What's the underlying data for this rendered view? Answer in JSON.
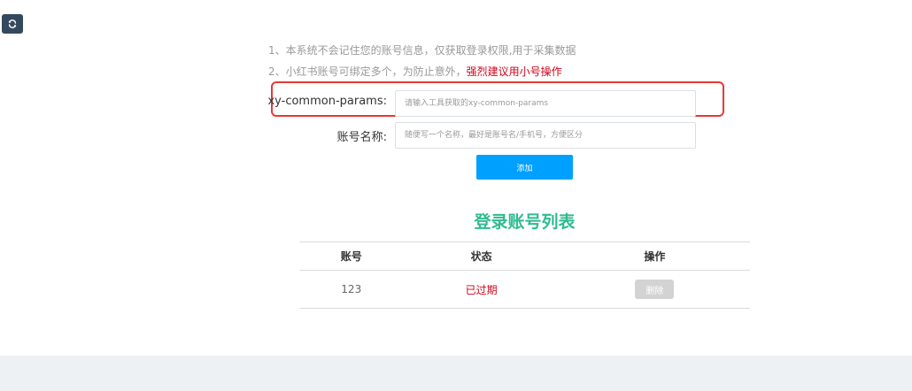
{
  "toolbar": {
    "refresh_icon": "refresh-icon"
  },
  "notes": {
    "line1": "1、本系统不会记住您的账号信息，仅获取登录权限,用于采集数据",
    "line2_prefix": "2、小红书账号可绑定多个，为防止意外，",
    "line2_warning": "强烈建议用小号操作"
  },
  "form": {
    "params_label": "xy-common-params:",
    "params_value": "",
    "params_placeholder": "请输入工具获取的xy-common-params",
    "name_label": "账号名称:",
    "name_value": "",
    "name_placeholder": "随便写一个名称，最好是账号名/手机号，方便区分",
    "add_button": "添加"
  },
  "account_list": {
    "title": "登录账号列表",
    "columns": [
      "账号",
      "状态",
      "操作"
    ],
    "rows": [
      {
        "account": "123",
        "status": "已过期",
        "action": "删除"
      }
    ]
  },
  "colors": {
    "accent": "#00a0ff",
    "title_green": "#2fbb8f",
    "warning_red": "#d0021b",
    "highlight_red": "#e53935",
    "refresh_bg": "#34495e"
  }
}
